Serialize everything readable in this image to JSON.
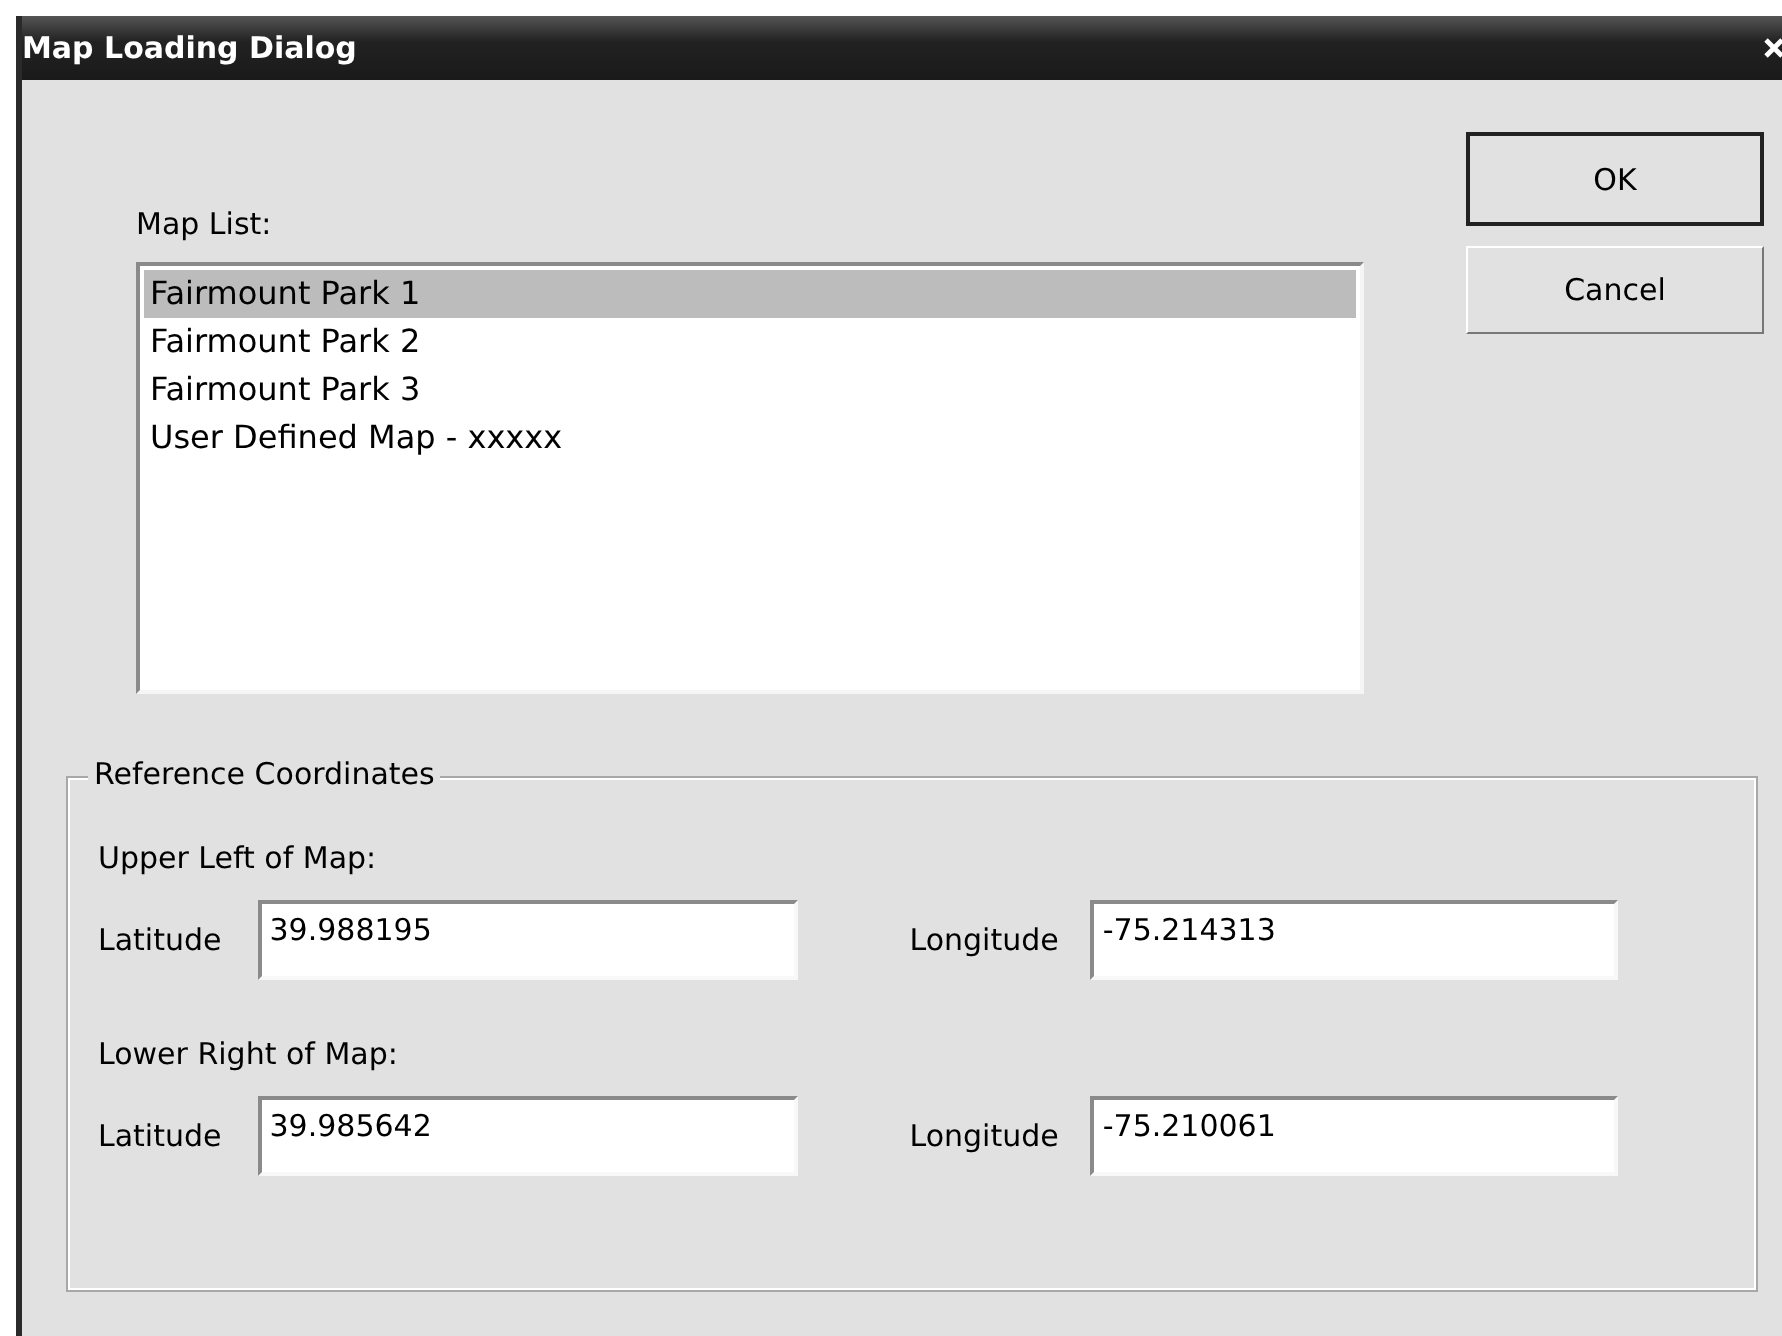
{
  "window": {
    "title": "Map Loading Dialog"
  },
  "map_list": {
    "label": "Map List:",
    "items": [
      {
        "label": "Fairmount Park 1",
        "selected": true
      },
      {
        "label": "Fairmount Park 2",
        "selected": false
      },
      {
        "label": "Fairmount Park 3",
        "selected": false
      },
      {
        "label": "User Defined Map - xxxxx",
        "selected": false
      }
    ]
  },
  "buttons": [
    {
      "label": "OK",
      "default": true
    },
    {
      "label": "Cancel",
      "default": false
    }
  ],
  "reference": {
    "title": "Reference Coordinates",
    "groups": [
      {
        "heading": "Upper Left of Map:",
        "fields": [
          {
            "label": "Latitude",
            "value": "39.988195"
          },
          {
            "label": "Longitude",
            "value": "-75.214313"
          }
        ]
      },
      {
        "heading": "Lower Right of Map:",
        "fields": [
          {
            "label": "Latitude",
            "value": "39.985642"
          },
          {
            "label": "Longitude",
            "value": "-75.210061"
          }
        ]
      }
    ]
  }
}
